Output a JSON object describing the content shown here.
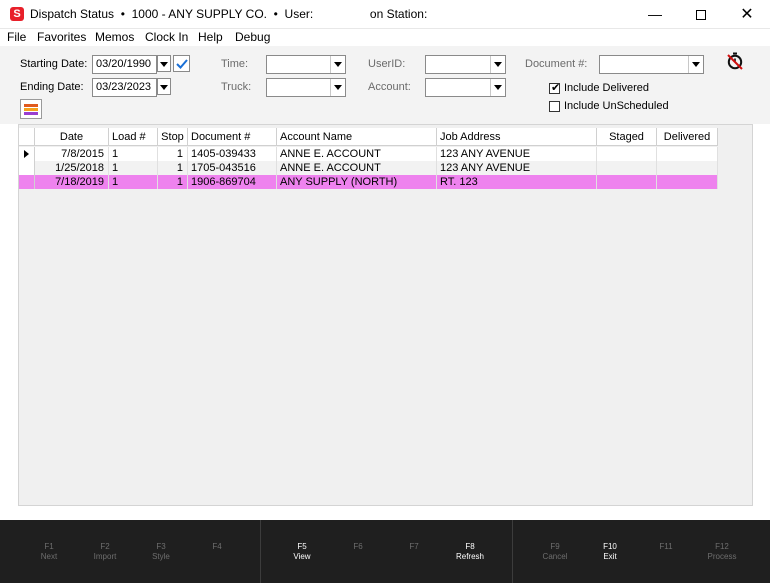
{
  "window": {
    "app_icon_letter": "S",
    "title_parts": [
      "Dispatch Status",
      "1000 - ANY SUPPLY CO.",
      "User:",
      "on Station:"
    ],
    "separator": "•",
    "minimize": "—",
    "close": "✕"
  },
  "menu": [
    "File",
    "Favorites",
    "Memos",
    "Clock In",
    "Help",
    "Debug"
  ],
  "filters": {
    "starting_date_label": "Starting Date:",
    "starting_date_value": "03/20/1990",
    "ending_date_label": "Ending Date:",
    "ending_date_value": "03/23/2023",
    "time_label": "Time:",
    "time_value": "",
    "truck_label": "Truck:",
    "truck_value": "",
    "userid_label": "UserID:",
    "userid_value": "",
    "account_label": "Account:",
    "account_value": "",
    "document_label": "Document #:",
    "document_value": "",
    "include_delivered_label": "Include Delivered",
    "include_delivered_checked": true,
    "include_unscheduled_label": "Include UnScheduled",
    "include_unscheduled_checked": false,
    "checkmark": "✔"
  },
  "grid": {
    "columns": [
      "Date",
      "Load #",
      "Stop",
      "Document #",
      "Account Name",
      "Job Address",
      "Staged",
      "Delivered"
    ],
    "rows": [
      {
        "date": "7/8/2015",
        "load": "1",
        "stop": "1",
        "document": "1405-039433",
        "account": "ANNE E. ACCOUNT",
        "address": "123 ANY AVENUE",
        "staged": "",
        "delivered": ""
      },
      {
        "date": "1/25/2018",
        "load": "1",
        "stop": "1",
        "document": "1705-043516",
        "account": "ANNE E. ACCOUNT",
        "address": "123 ANY AVENUE",
        "staged": "",
        "delivered": ""
      },
      {
        "date": "7/18/2019",
        "load": "1",
        "stop": "1",
        "document": "1906-869704",
        "account": "ANY SUPPLY (NORTH)",
        "address": "RT. 123",
        "staged": "",
        "delivered": ""
      }
    ],
    "selected_row_color": "#ee82ee"
  },
  "function_keys": [
    {
      "key": "F1",
      "action": "Next",
      "enabled": false
    },
    {
      "key": "F2",
      "action": "Import",
      "enabled": false
    },
    {
      "key": "F3",
      "action": "Style",
      "enabled": false
    },
    {
      "key": "F4",
      "action": "",
      "enabled": false
    },
    {
      "key": "F5",
      "action": "View",
      "enabled": true
    },
    {
      "key": "F6",
      "action": "",
      "enabled": false
    },
    {
      "key": "F7",
      "action": "",
      "enabled": false
    },
    {
      "key": "F8",
      "action": "Refresh",
      "enabled": true
    },
    {
      "key": "F9",
      "action": "Cancel",
      "enabled": false
    },
    {
      "key": "F10",
      "action": "Exit",
      "enabled": true
    },
    {
      "key": "F11",
      "action": "",
      "enabled": false
    },
    {
      "key": "F12",
      "action": "Process",
      "enabled": false
    }
  ],
  "icons": {
    "app": "app-logo-icon",
    "calendar_confirm": "checkmark-icon",
    "color_settings": "color-bars-icon",
    "timer": "stopwatch-off-icon"
  }
}
